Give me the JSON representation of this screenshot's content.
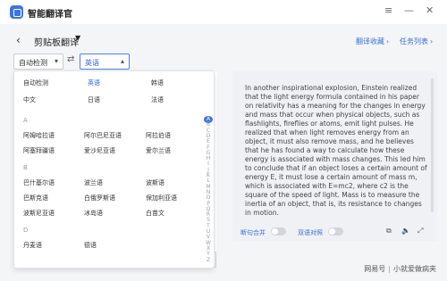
{
  "app": {
    "title": "智能翻译官"
  },
  "window": {
    "menu_icon": "≡",
    "minimize_icon": "—",
    "close_icon": "✕"
  },
  "header": {
    "back_icon": "‹",
    "page_title": "剪贴板翻译",
    "title_caret": "▼",
    "link_favorites": "翻译收藏",
    "link_tasks": "任务列表",
    "link_arrow": "›"
  },
  "language_bar": {
    "source": "自动检测",
    "target": "英语",
    "swap_icon": "⇄",
    "dropdown_icon_source": "▾",
    "dropdown_icon_target": "▴"
  },
  "dropdown": {
    "quick_row1": [
      "自动检测",
      "英语",
      "韩语"
    ],
    "quick_row2": [
      "中文",
      "日语",
      "法语"
    ],
    "section_a_letter": "A",
    "section_a_rows": [
      [
        "阿姆哈拉语",
        "阿尔巴尼亚语",
        "阿拉伯语"
      ],
      [
        "阿塞拜疆语",
        "爱沙尼亚语",
        "爱尔兰语"
      ]
    ],
    "section_b_letter": "B",
    "section_b_rows": [
      [
        "巴什基尔语",
        "波兰语",
        "波斯语"
      ],
      [
        "巴斯克语",
        "白俄罗斯语",
        "保加利亚语"
      ],
      [
        "波斯尼亚语",
        "冰岛语",
        "白苗文"
      ]
    ],
    "section_d_letter": "D",
    "section_d_rows": [
      [
        "丹麦语",
        "德语"
      ]
    ],
    "index": [
      "A",
      "B",
      "C",
      "D",
      "E",
      "F",
      "G",
      "H",
      "I",
      "J",
      "K",
      "L",
      "M",
      "N",
      "O",
      "P",
      "Q",
      "R",
      "S",
      "T",
      "U",
      "V",
      "W",
      "X",
      "Y",
      "Z"
    ]
  },
  "result": {
    "text": "In another inspirational explosion, Einstein realized that the light energy formula contained in his paper on relativity has a meaning for the changes in energy and mass that occur when physical objects, such as flashlights, fireflies or atoms, emit light pulses. He realized that when light removes energy from an object, it must also remove mass, and he believes that he has found a way to calculate how these energy is associated with mass changes. This led him to conclude that if an object loses a certain amount of energy E, it must lose a certain amount of mass m, which is associated with E=mc2, where c2 is the square of the speed of light. Mass is to measure the inertia of an object, that is, its resistance to changes in motion."
  },
  "toolbar": {
    "merge_label": "断句合并",
    "bilingual_label": "双语对照",
    "copy_icon": "⧉",
    "speaker_icon": "🔈",
    "fullscreen_icon": "⤢"
  },
  "watermark": {
    "left": "网易号",
    "right": "小就爱做病夹"
  }
}
